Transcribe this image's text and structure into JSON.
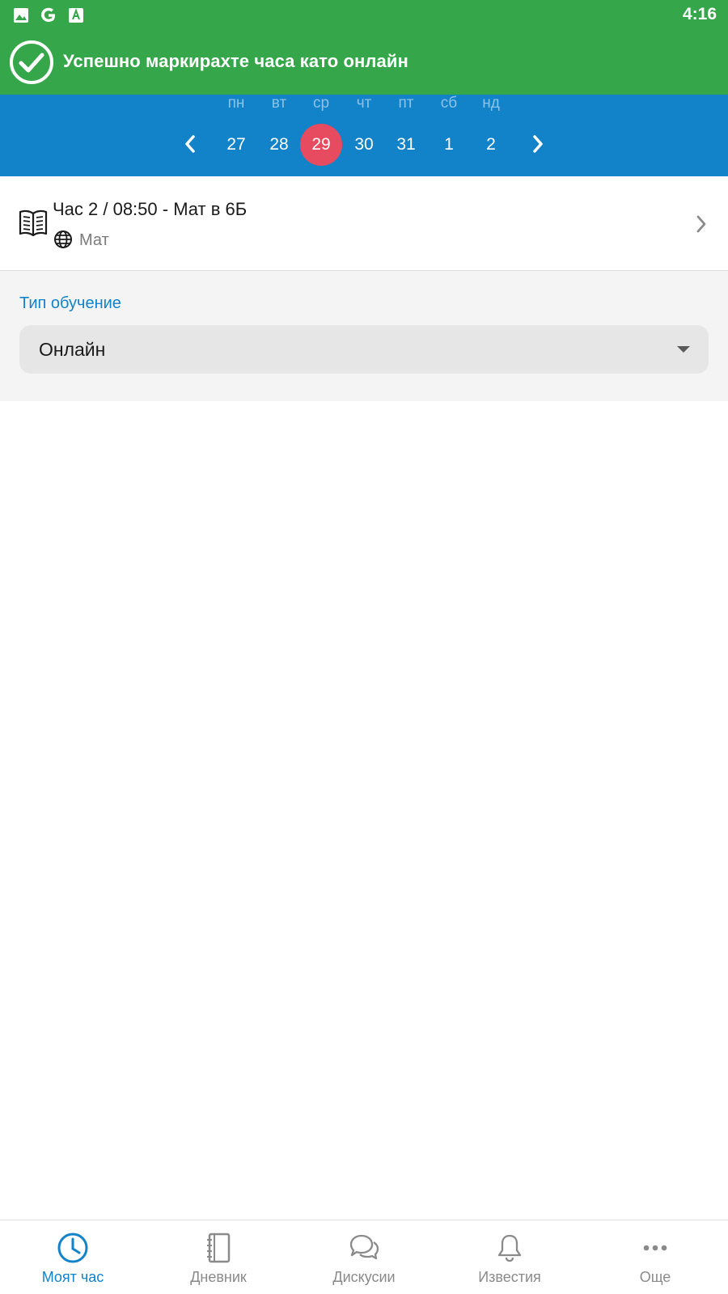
{
  "status_bar": {
    "time": "4:16",
    "icons": [
      "image-icon",
      "google-icon",
      "font-icon"
    ]
  },
  "banner": {
    "message": "Успешно маркирахте часа като онлайн",
    "color": "#36a64a"
  },
  "week": {
    "days": [
      {
        "name": "пн",
        "num": "27"
      },
      {
        "name": "вт",
        "num": "28"
      },
      {
        "name": "ср",
        "num": "29"
      },
      {
        "name": "чт",
        "num": "30"
      },
      {
        "name": "пт",
        "num": "31"
      },
      {
        "name": "сб",
        "num": "1"
      },
      {
        "name": "нд",
        "num": "2"
      }
    ],
    "selected_index": 2,
    "strip_color": "#1282c9",
    "selected_color": "#e64b5f"
  },
  "lesson": {
    "title": "Час 2 / 08:50 - Мат в 6Б",
    "subject": "Мат",
    "icon": "book-icon",
    "mode_icon": "globe-icon"
  },
  "form": {
    "label": "Тип обучение",
    "select_value": "Онлайн"
  },
  "bottom_nav": {
    "active_index": 0,
    "items": [
      {
        "label": "Моят час",
        "icon": "clock-icon"
      },
      {
        "label": "Дневник",
        "icon": "notebook-icon"
      },
      {
        "label": "Дискусии",
        "icon": "chat-bubbles-icon"
      },
      {
        "label": "Известия",
        "icon": "bell-icon"
      },
      {
        "label": "Още",
        "icon": "more-dots-icon"
      }
    ],
    "active_color": "#1282c9"
  }
}
